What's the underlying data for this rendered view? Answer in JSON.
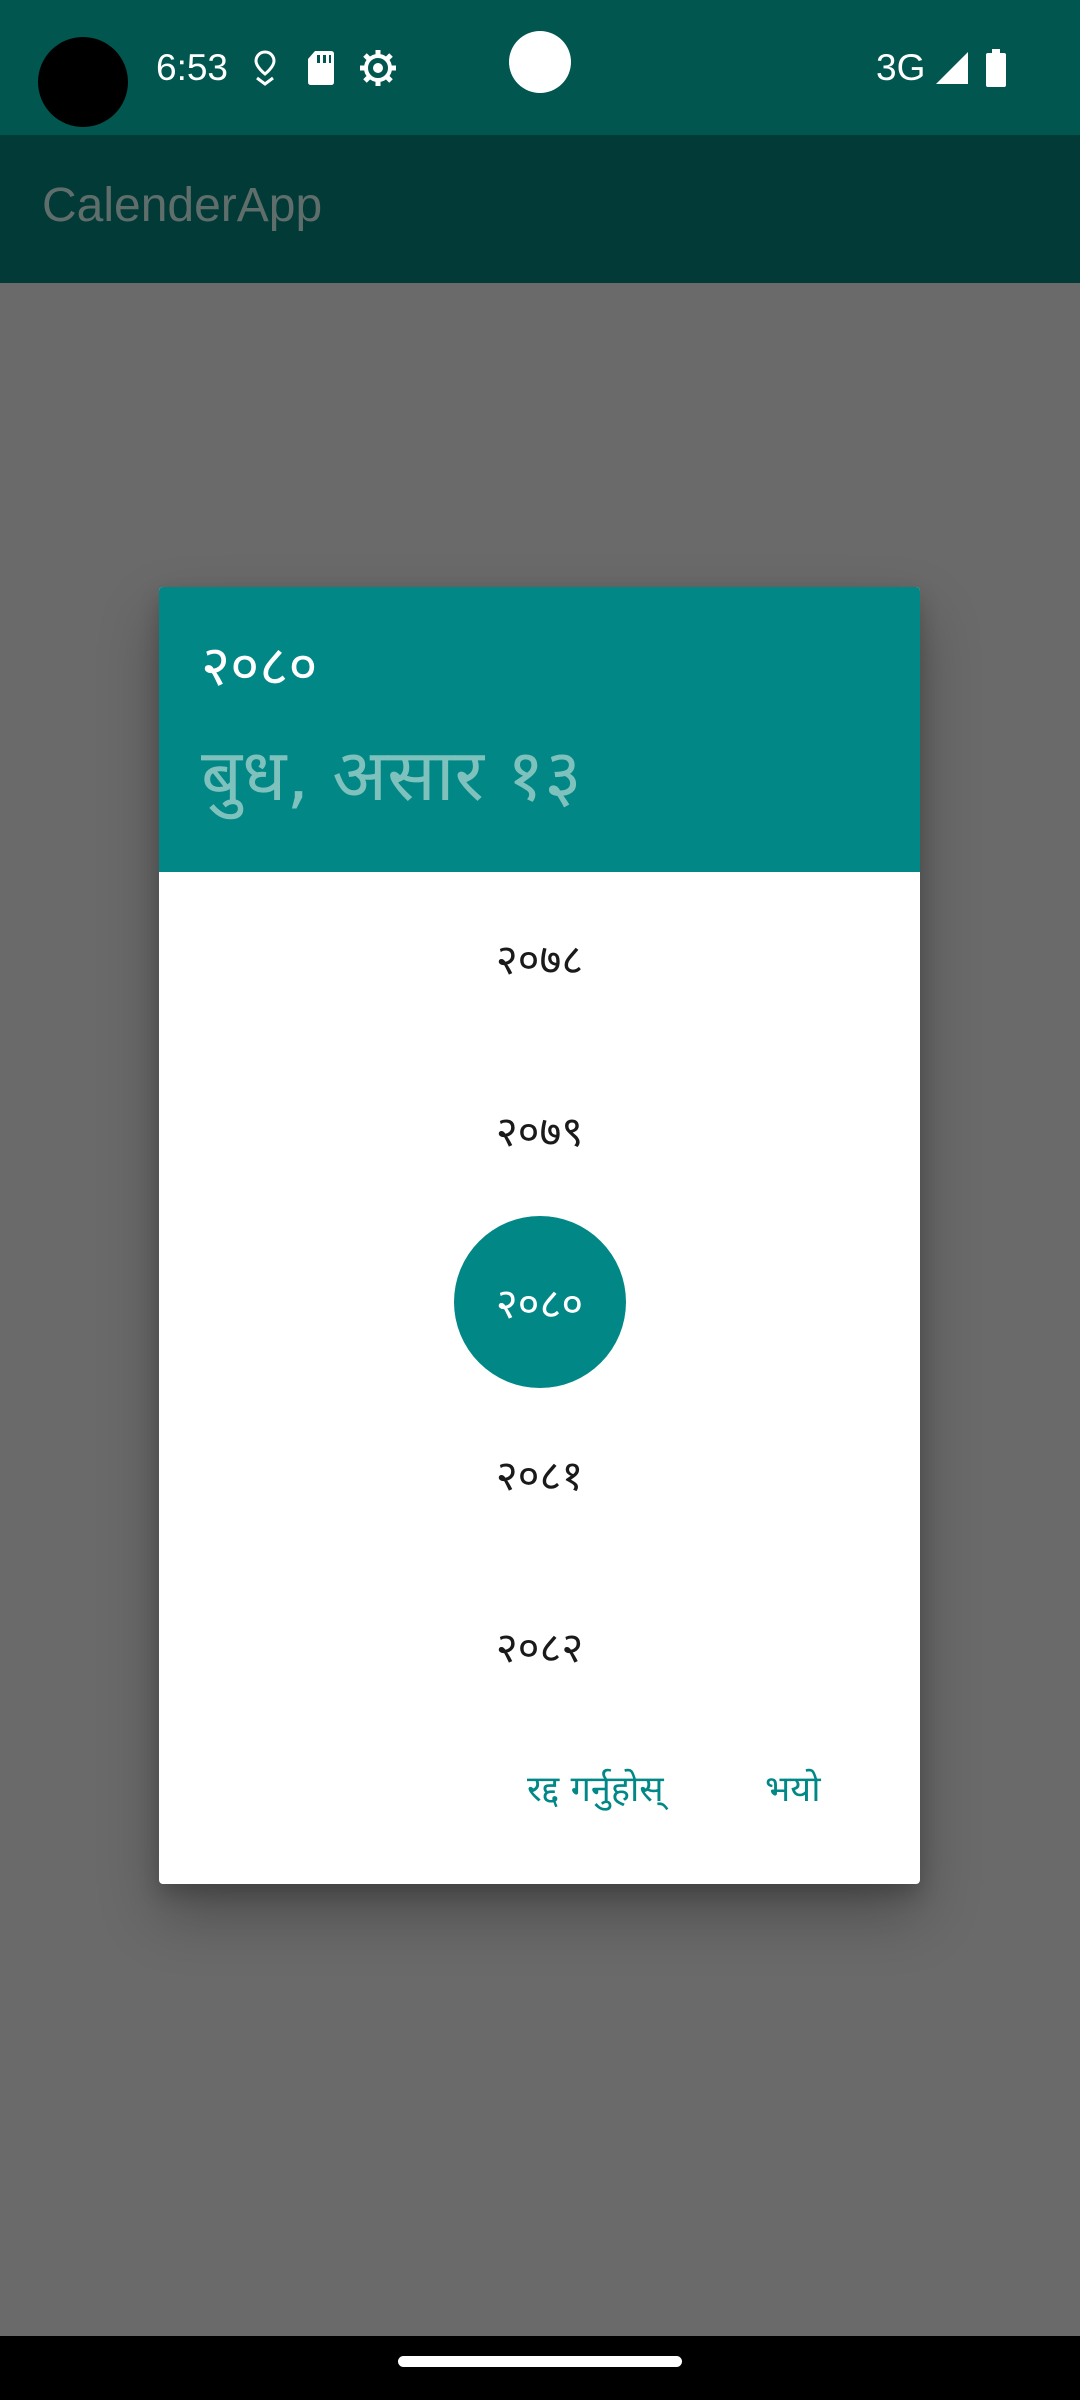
{
  "status_bar": {
    "time": "6:53",
    "network": "3G",
    "icons": [
      "location-pin-icon",
      "sd-card-icon",
      "settings-gear-icon",
      "signal-icon",
      "battery-icon"
    ]
  },
  "app_bar": {
    "title": "CalenderApp"
  },
  "dialog": {
    "header": {
      "year": "२०८०",
      "date": "बुध, असार १३"
    },
    "years": [
      {
        "label": "२०७८",
        "selected": false
      },
      {
        "label": "२०७९",
        "selected": false
      },
      {
        "label": "२०८०",
        "selected": true
      },
      {
        "label": "२०८१",
        "selected": false
      },
      {
        "label": "२०८२",
        "selected": false
      }
    ],
    "actions": {
      "cancel": "रद्द गर्नुहोस्",
      "ok": "भयो"
    }
  },
  "colors": {
    "status_bar": "#01574f",
    "app_bar": "#013a37",
    "accent": "#018786",
    "scrim": "#6a6a6a",
    "header_date": "#7fc1bd"
  }
}
